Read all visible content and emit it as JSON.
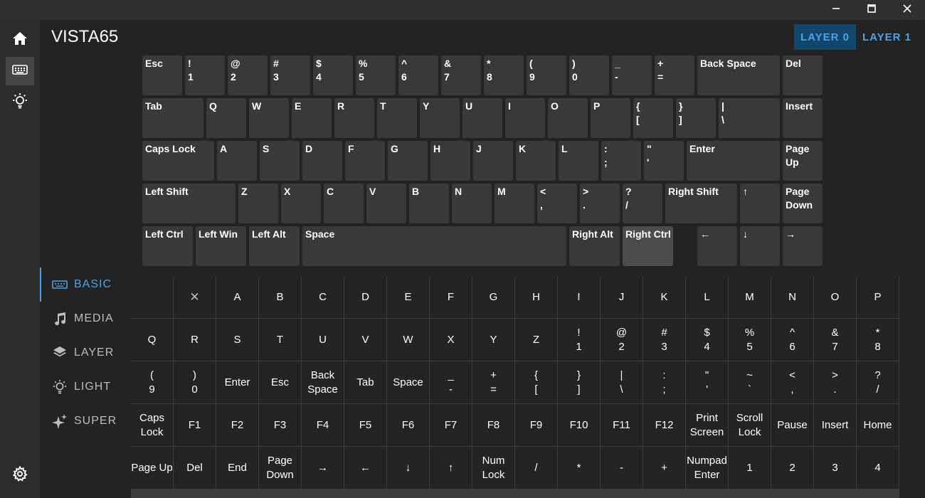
{
  "window": {
    "minimize_icon": "minimize-icon",
    "maximize_icon": "maximize-icon",
    "close_icon": "close-icon"
  },
  "sidebar": {
    "items": [
      {
        "name": "home",
        "icon": "home-icon"
      },
      {
        "name": "keymap",
        "icon": "keyboard-icon",
        "active": true
      },
      {
        "name": "lighting",
        "icon": "lightbulb-icon"
      }
    ],
    "settings_icon": "gear-icon"
  },
  "header": {
    "device_name": "VISTA65"
  },
  "layers": [
    {
      "label": "LAYER 0",
      "active": true
    },
    {
      "label": "LAYER 1",
      "active": false
    }
  ],
  "keyboard_rows": [
    [
      [
        "Esc",
        ""
      ],
      [
        "!",
        "1"
      ],
      [
        "@",
        "2"
      ],
      [
        "#",
        "3"
      ],
      [
        "$",
        "4"
      ],
      [
        "%",
        "5"
      ],
      [
        "^",
        "6"
      ],
      [
        "&",
        "7"
      ],
      [
        "*",
        "8"
      ],
      [
        "(",
        "9"
      ],
      [
        ")",
        "0"
      ],
      [
        "_",
        "-"
      ],
      [
        "+",
        "="
      ],
      [
        "Back Space",
        ""
      ],
      [
        "Del",
        ""
      ]
    ],
    [
      [
        "Tab",
        ""
      ],
      [
        "Q",
        ""
      ],
      [
        "W",
        ""
      ],
      [
        "E",
        ""
      ],
      [
        "R",
        ""
      ],
      [
        "T",
        ""
      ],
      [
        "Y",
        ""
      ],
      [
        "U",
        ""
      ],
      [
        "I",
        ""
      ],
      [
        "O",
        ""
      ],
      [
        "P",
        ""
      ],
      [
        "{",
        "["
      ],
      [
        "}",
        "]"
      ],
      [
        "|",
        "\\"
      ],
      [
        "Insert",
        ""
      ]
    ],
    [
      [
        "Caps Lock",
        ""
      ],
      [
        "A",
        ""
      ],
      [
        "S",
        ""
      ],
      [
        "D",
        ""
      ],
      [
        "F",
        ""
      ],
      [
        "G",
        ""
      ],
      [
        "H",
        ""
      ],
      [
        "J",
        ""
      ],
      [
        "K",
        ""
      ],
      [
        "L",
        ""
      ],
      [
        ":",
        ";"
      ],
      [
        "\"",
        "'"
      ],
      [
        "Enter",
        ""
      ],
      [
        "Page",
        "Up"
      ]
    ],
    [
      [
        "Left Shift",
        ""
      ],
      [
        "Z",
        ""
      ],
      [
        "X",
        ""
      ],
      [
        "C",
        ""
      ],
      [
        "V",
        ""
      ],
      [
        "B",
        ""
      ],
      [
        "N",
        ""
      ],
      [
        "M",
        ""
      ],
      [
        "<",
        ","
      ],
      [
        ">",
        "."
      ],
      [
        "?",
        "/"
      ],
      [
        "Right Shift",
        ""
      ],
      [
        "↑",
        ""
      ],
      [
        "Page",
        "Down"
      ]
    ],
    [
      [
        "Left Ctrl",
        ""
      ],
      [
        "Left Win",
        ""
      ],
      [
        "Left Alt",
        ""
      ],
      [
        "Space",
        ""
      ],
      [
        "Right Alt",
        ""
      ],
      [
        "Right Ctrl",
        ""
      ],
      [
        "←",
        ""
      ],
      [
        "↓",
        ""
      ],
      [
        "→",
        ""
      ]
    ]
  ],
  "selected_key": "Right Ctrl",
  "categories": [
    {
      "label": "BASIC",
      "icon": "keyboard-icon",
      "active": true
    },
    {
      "label": "MEDIA",
      "icon": "music-note-icon",
      "active": false
    },
    {
      "label": "LAYER",
      "icon": "layers-icon",
      "active": false
    },
    {
      "label": "LIGHT",
      "icon": "lightbulb-icon",
      "active": false
    },
    {
      "label": "SUPER",
      "icon": "sparkle-icon",
      "active": false
    }
  ],
  "palette_rows": [
    [
      [
        "",
        ""
      ],
      [
        "✕",
        ""
      ],
      [
        "A",
        ""
      ],
      [
        "B",
        ""
      ],
      [
        "C",
        ""
      ],
      [
        "D",
        ""
      ],
      [
        "E",
        ""
      ],
      [
        "F",
        ""
      ],
      [
        "G",
        ""
      ],
      [
        "H",
        ""
      ],
      [
        "I",
        ""
      ],
      [
        "J",
        ""
      ],
      [
        "K",
        ""
      ],
      [
        "L",
        ""
      ],
      [
        "M",
        ""
      ],
      [
        "N",
        ""
      ],
      [
        "O",
        ""
      ],
      [
        "P",
        ""
      ]
    ],
    [
      [
        "Q",
        ""
      ],
      [
        "R",
        ""
      ],
      [
        "S",
        ""
      ],
      [
        "T",
        ""
      ],
      [
        "U",
        ""
      ],
      [
        "V",
        ""
      ],
      [
        "W",
        ""
      ],
      [
        "X",
        ""
      ],
      [
        "Y",
        ""
      ],
      [
        "Z",
        ""
      ],
      [
        "!",
        "1"
      ],
      [
        "@",
        "2"
      ],
      [
        "#",
        "3"
      ],
      [
        "$",
        "4"
      ],
      [
        "%",
        "5"
      ],
      [
        "^",
        "6"
      ],
      [
        "&",
        "7"
      ],
      [
        "*",
        "8"
      ]
    ],
    [
      [
        "(",
        "9"
      ],
      [
        ")",
        "0"
      ],
      [
        "Enter",
        ""
      ],
      [
        "Esc",
        ""
      ],
      [
        "Back",
        "Space"
      ],
      [
        "Tab",
        ""
      ],
      [
        "Space",
        ""
      ],
      [
        "_",
        "-"
      ],
      [
        "+",
        "="
      ],
      [
        "{",
        "["
      ],
      [
        "}",
        "]"
      ],
      [
        "|",
        "\\"
      ],
      [
        ":",
        ";"
      ],
      [
        "\"",
        "'"
      ],
      [
        "~",
        "`"
      ],
      [
        "<",
        ","
      ],
      [
        ">",
        "."
      ],
      [
        "?",
        "/"
      ]
    ],
    [
      [
        "Caps",
        "Lock"
      ],
      [
        "F1",
        ""
      ],
      [
        "F2",
        ""
      ],
      [
        "F3",
        ""
      ],
      [
        "F4",
        ""
      ],
      [
        "F5",
        ""
      ],
      [
        "F6",
        ""
      ],
      [
        "F7",
        ""
      ],
      [
        "F8",
        ""
      ],
      [
        "F9",
        ""
      ],
      [
        "F10",
        ""
      ],
      [
        "F11",
        ""
      ],
      [
        "F12",
        ""
      ],
      [
        "Print",
        "Screen"
      ],
      [
        "Scroll",
        "Lock"
      ],
      [
        "Pause",
        ""
      ],
      [
        "Insert",
        ""
      ],
      [
        "Home",
        ""
      ]
    ],
    [
      [
        "Page Up",
        ""
      ],
      [
        "Del",
        ""
      ],
      [
        "End",
        ""
      ],
      [
        "Page",
        "Down"
      ],
      [
        "→",
        ""
      ],
      [
        "←",
        ""
      ],
      [
        "↓",
        ""
      ],
      [
        "↑",
        ""
      ],
      [
        "Num",
        "Lock"
      ],
      [
        "/",
        ""
      ],
      [
        "*",
        ""
      ],
      [
        "-",
        ""
      ],
      [
        "+",
        ""
      ],
      [
        "Numpad",
        "Enter"
      ],
      [
        "1",
        ""
      ],
      [
        "2",
        ""
      ],
      [
        "3",
        ""
      ],
      [
        "4",
        ""
      ]
    ]
  ]
}
